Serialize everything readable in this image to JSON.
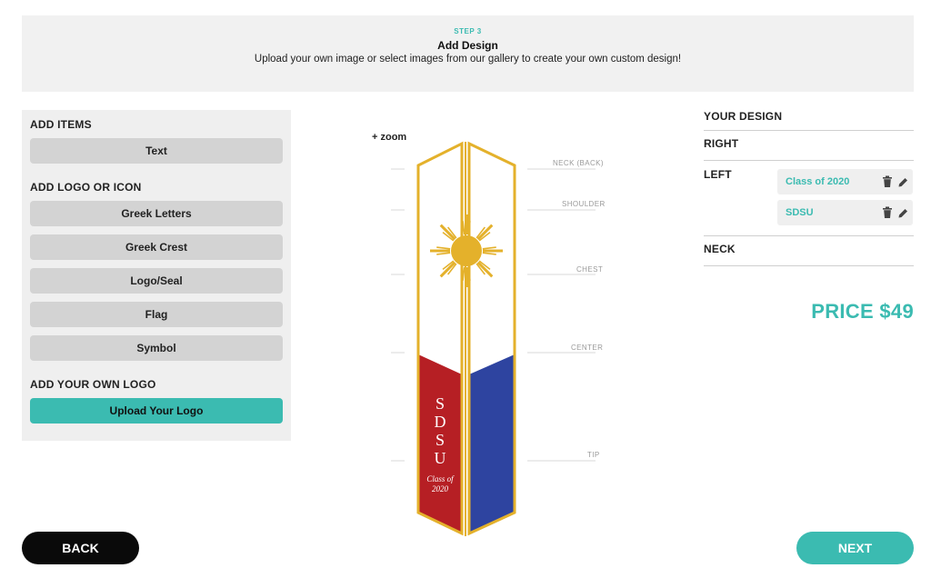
{
  "header": {
    "step": "STEP 3",
    "title": "Add Design",
    "subtitle": "Upload your own image or select images from our gallery to create your own custom design!"
  },
  "left_panel": {
    "add_items_title": "ADD ITEMS",
    "text_button": "Text",
    "logo_title": "ADD LOGO OR ICON",
    "logo_buttons": [
      "Greek Letters",
      "Greek Crest",
      "Logo/Seal",
      "Flag",
      "Symbol"
    ],
    "own_logo_title": "ADD YOUR OWN LOGO",
    "upload_button": "Upload Your Logo"
  },
  "preview": {
    "zoom_label": "+ zoom",
    "guides": [
      "NECK (BACK)",
      "SHOULDER",
      "CHEST",
      "CENTER",
      "TIP"
    ],
    "stole_text_letters": [
      "S",
      "D",
      "S",
      "U"
    ],
    "stole_subtext_1": "Class of",
    "stole_subtext_2": "2020",
    "colors": {
      "trim": "#e4b12b",
      "sun": "#e4b12b",
      "red": "#b61f24",
      "blue": "#2e44a0",
      "panel": "#ffffff"
    }
  },
  "design_panel": {
    "title": "YOUR DESIGN",
    "right_label": "RIGHT",
    "left_label": "LEFT",
    "neck_label": "NECK",
    "left_items": [
      "Class of 2020",
      "SDSU"
    ],
    "item_icons": [
      "trash-icon",
      "pencil-icon"
    ]
  },
  "price": "PRICE $49",
  "nav": {
    "back_label": "BACK",
    "next_label": "NEXT"
  },
  "accent_color": "#3bbbb1"
}
